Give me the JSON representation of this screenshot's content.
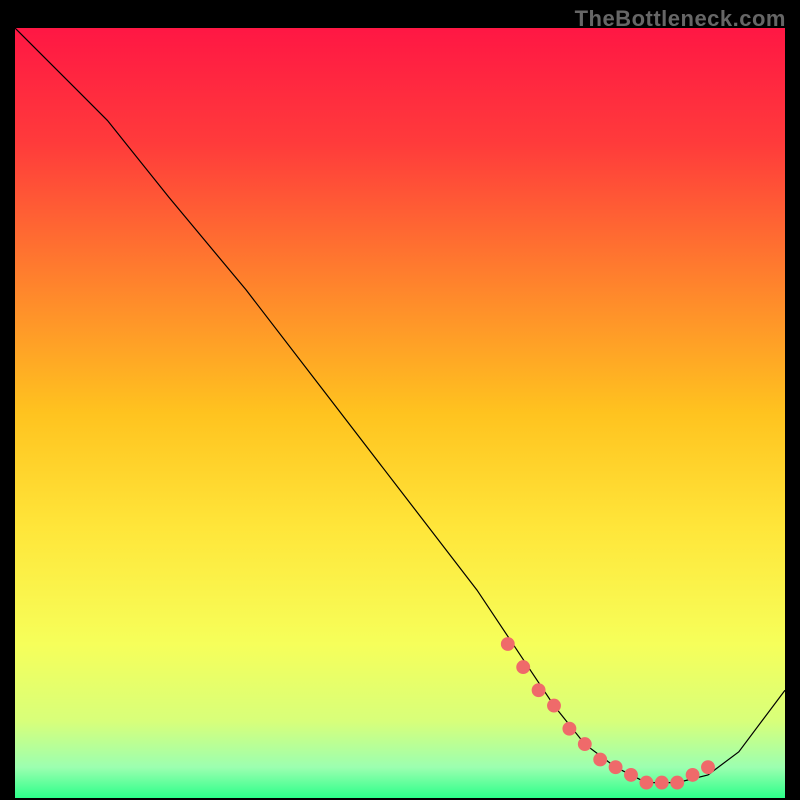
{
  "watermark": "TheBottleneck.com",
  "chart_data": {
    "type": "line",
    "title": "",
    "xlabel": "",
    "ylabel": "",
    "xlim": [
      0,
      100
    ],
    "ylim": [
      0,
      100
    ],
    "gradient_stops": [
      {
        "offset": 0.0,
        "color": "#ff1744"
      },
      {
        "offset": 0.15,
        "color": "#ff3b3b"
      },
      {
        "offset": 0.35,
        "color": "#ff8a2b"
      },
      {
        "offset": 0.5,
        "color": "#ffc31f"
      },
      {
        "offset": 0.65,
        "color": "#ffe63a"
      },
      {
        "offset": 0.8,
        "color": "#f6ff5a"
      },
      {
        "offset": 0.9,
        "color": "#d8ff7a"
      },
      {
        "offset": 0.96,
        "color": "#9cffb0"
      },
      {
        "offset": 1.0,
        "color": "#2cff8a"
      }
    ],
    "series": [
      {
        "name": "bottleneck-curve",
        "x": [
          0,
          4,
          8,
          12,
          20,
          30,
          40,
          50,
          60,
          66,
          70,
          74,
          78,
          82,
          86,
          90,
          94,
          100
        ],
        "y": [
          100,
          96,
          92,
          88,
          78,
          66,
          53,
          40,
          27,
          18,
          12,
          7,
          4,
          2,
          2,
          3,
          6,
          14
        ]
      }
    ],
    "markers": {
      "name": "highlight-dots",
      "color": "#ef6a6a",
      "x": [
        64,
        66,
        68,
        70,
        72,
        74,
        76,
        78,
        80,
        82,
        84,
        86,
        88,
        90
      ],
      "y": [
        20,
        17,
        14,
        12,
        9,
        7,
        5,
        4,
        3,
        2,
        2,
        2,
        3,
        4
      ]
    }
  }
}
